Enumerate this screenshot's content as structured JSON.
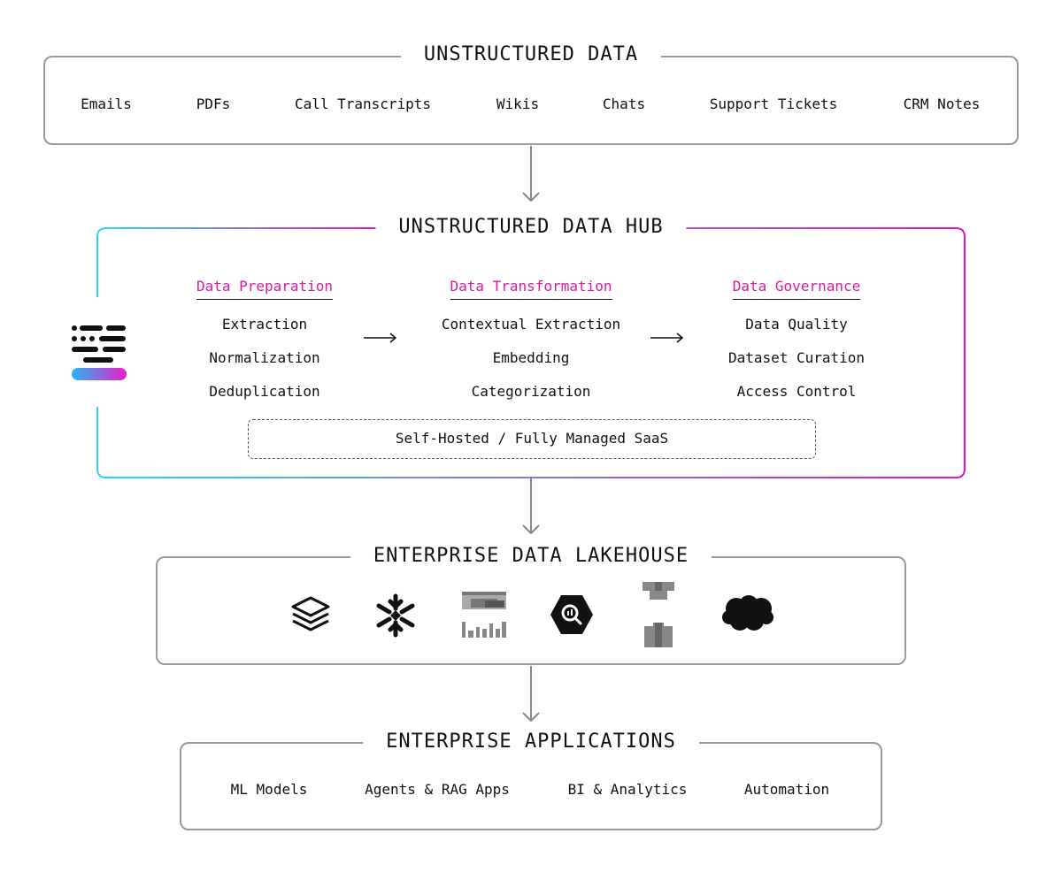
{
  "sections": {
    "unstructured": {
      "title": "UNSTRUCTURED DATA",
      "items": [
        "Emails",
        "PDFs",
        "Call Transcripts",
        "Wikis",
        "Chats",
        "Support Tickets",
        "CRM Notes"
      ]
    },
    "hub": {
      "title": "UNSTRUCTURED DATA HUB",
      "columns": [
        {
          "title": "Data Preparation",
          "items": [
            "Extraction",
            "Normalization",
            "Deduplication"
          ]
        },
        {
          "title": "Data Transformation",
          "items": [
            "Contextual Extraction",
            "Embedding",
            "Categorization"
          ]
        },
        {
          "title": "Data Governance",
          "items": [
            "Data Quality",
            "Dataset Curation",
            "Access Control"
          ]
        }
      ],
      "deployment": "Self-Hosted / Fully Managed SaaS",
      "accent_colors": {
        "title": "#d81b9e",
        "gradient_start": "#29d6f2",
        "gradient_end": "#d81bbf"
      }
    },
    "lakehouse": {
      "title": "ENTERPRISE DATA LAKEHOUSE",
      "logos": [
        "databricks-logo",
        "snowflake-logo",
        "amazon-s3-logo",
        "bigquery-logo",
        "amazon-redshift-logo",
        "salesforce-logo"
      ]
    },
    "applications": {
      "title": "ENTERPRISE APPLICATIONS",
      "items": [
        "ML Models",
        "Agents & RAG Apps",
        "BI & Analytics",
        "Automation"
      ]
    }
  }
}
